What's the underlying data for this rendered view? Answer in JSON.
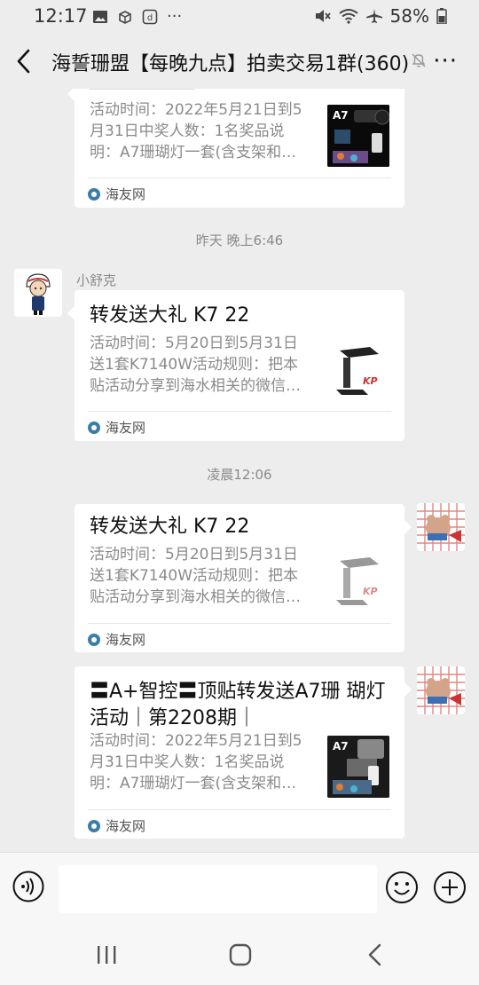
{
  "status_bar": {
    "time": "12:17",
    "battery": "58%"
  },
  "header": {
    "title": "海誓珊盟【每晚九点】拍卖交易1群(360)",
    "more": "···"
  },
  "messages": [
    {
      "desc": "活动时间：2022年5月21日到5月31日中奖人数：1名奖品说明：A7珊瑚灯一套(含支架和…",
      "source": "海友网"
    },
    {
      "timestamp": "昨天 晚上6:46"
    },
    {
      "sender": "小舒克",
      "title": "转发送大礼 K7 22",
      "desc": "活动时间：5月20日到5月31日送1套K7140W活动规则：把本贴活动分享到海水相关的微信…",
      "source": "海友网"
    },
    {
      "timestamp": "凌晨12:06"
    },
    {
      "title": "转发送大礼 K7 22",
      "desc": "活动时间：5月20日到5月31日送1套K7140W活动规则：把本贴活动分享到海水相关的微信…",
      "source": "海友网"
    },
    {
      "title": "〓A+智控〓顶贴转发送A7珊 瑚灯活动｜第2208期｜",
      "desc": "活动时间：2022年5月21日到5月31日中奖人数：1名奖品说明：A7珊瑚灯一套(含支架和…",
      "source": "海友网"
    }
  ],
  "thumbs": {
    "a7_label": "A7",
    "kp_label": "KP"
  },
  "colors": {
    "background": "#ededed",
    "bubble": "#ffffff",
    "muted_text": "#8a8a8a"
  }
}
